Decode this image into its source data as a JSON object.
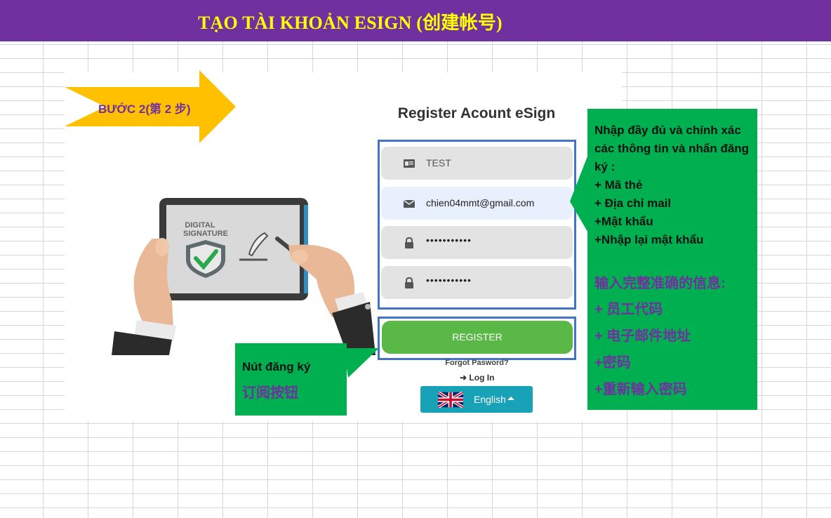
{
  "banner": {
    "title": "TẠO TÀI KHOẢN ESIGN (创建帐号)"
  },
  "step": {
    "label": "BƯỚC 2(第 2 步)"
  },
  "illustration": {
    "line1": "DIGITAL",
    "line2": "SIGNATURE"
  },
  "form": {
    "title": "Register Acount eSign",
    "employee_code": "TEST",
    "email": "chien04mmt@gmail.com",
    "password": "•••••••••••",
    "confirm_password": "•••••••••••",
    "register_label": "REGISTER",
    "forgot_label": "Forgot Pasword?",
    "login_arrow": "➜",
    "login_label": "Log In",
    "language": "English"
  },
  "callout_info": {
    "vn_lines": [
      "Nhập đầy đủ và chính xác các thông tin và nhấn đăng ký :",
      "+ Mã thẻ",
      "+ Địa chỉ mail",
      "+Mật khẩu",
      "+Nhập lại mật khẩu"
    ],
    "zh_lines": [
      "输入完整准确的信息:",
      "+ 员工代码",
      "+ 电子邮件地址",
      "+密码",
      "+重新输入密码"
    ]
  },
  "callout_button": {
    "vn": "Nút đăng ký",
    "zh": "订阅按钮"
  },
  "colors": {
    "banner": "#7030a0",
    "banner_text": "#ffff00",
    "arrow": "#ffc000",
    "callout": "#00b050",
    "frame": "#4472c4",
    "register_button": "#5ab846",
    "language_button": "#17a2b8"
  }
}
